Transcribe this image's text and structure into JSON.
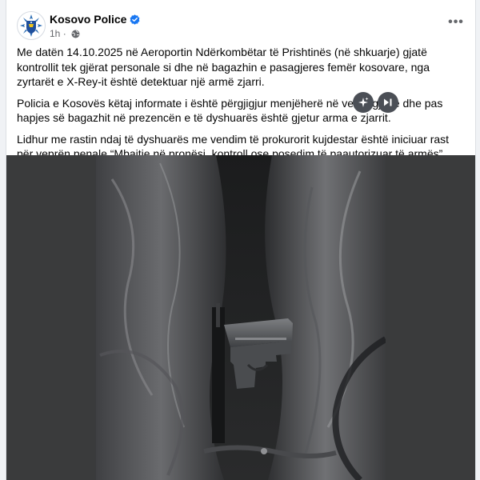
{
  "post": {
    "author": "Kosovo Police",
    "timestamp": "1h",
    "more_label": "•••",
    "paragraphs": [
      "Me datën 14.10.2025 në Aeroportin Ndërkombëtar të Prishtinës (në shkuarje) gjatë kontrollit tek gjërat personale si dhe në bagazhin e pasagjeres femër kosovare, nga zyrtarët e X-Rey-it është detektuar një armë zjarri.",
      "Policia e Kosovës këtaj informate i është përgjigjur menjëherë në vendngjarje dhe  pas hapjes së bagazhit në prezencën e të dyshuarës është gjetur arma e zjarrit.",
      "Lidhur me rastin ndaj të dyshuarës me vendim të prokurorit kujdestar është iniciuar rast për veprën penale “Mbajtje në pronësi, kontroll ose posedim të paautorizuar të armës”."
    ]
  },
  "icons": {
    "avatar": "kosovo-police-emblem",
    "verified": "verified-badge-icon",
    "audience": "globe-icon",
    "sparkle": "sparkle-icon",
    "skip": "skip-forward-icon",
    "more": "more-horizontal-icon"
  },
  "colors": {
    "verified": "#1877f2",
    "meta_text": "#65676b",
    "media_bg": "#3a3b3c",
    "float_button": "#4b4f56"
  },
  "media": {
    "type": "photo"
  }
}
